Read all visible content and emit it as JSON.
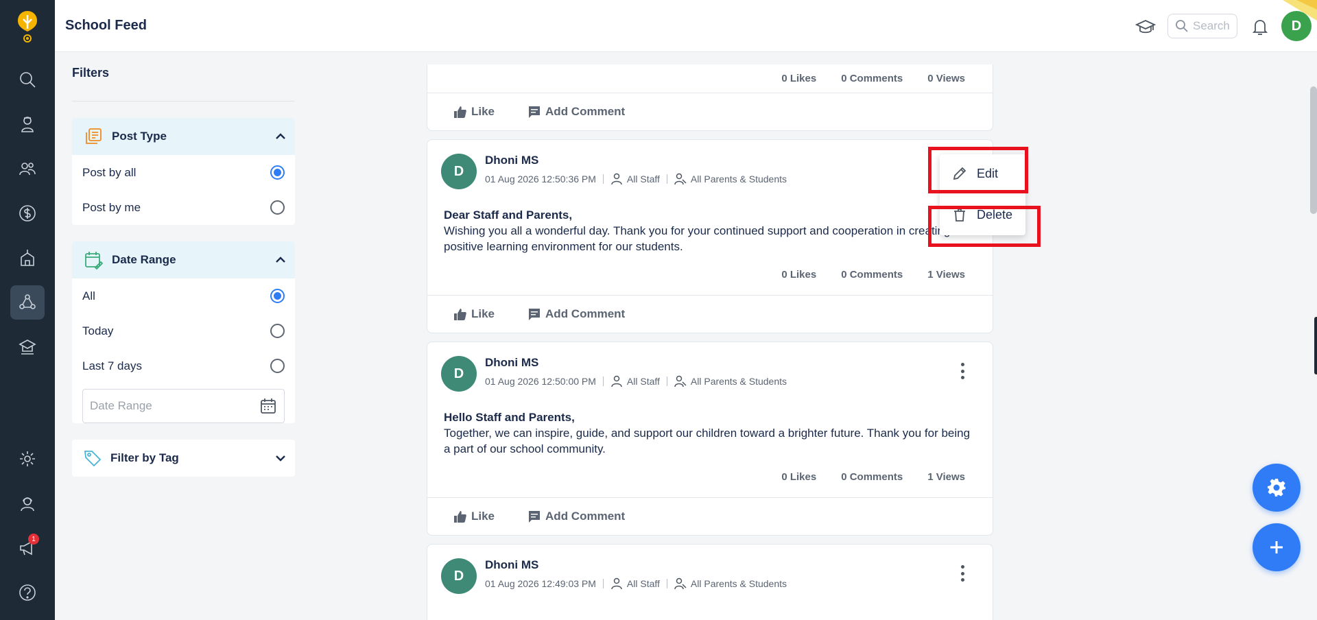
{
  "app": {
    "title": "School Feed",
    "search_placeholder": "Search",
    "user_initial": "D",
    "notification_count": "1"
  },
  "filters": {
    "heading": "Filters",
    "post_type": {
      "label": "Post Type",
      "options": [
        "Post by all",
        "Post by me"
      ],
      "selected": "Post by all"
    },
    "date_range": {
      "label": "Date Range",
      "options": [
        "All",
        "Today",
        "Last 7 days"
      ],
      "selected": "All",
      "input_placeholder": "Date Range"
    },
    "tag": {
      "label": "Filter by Tag"
    }
  },
  "feed": {
    "partial_post": {
      "likes": "0 Likes",
      "comments": "0 Comments",
      "views": "0 Views"
    },
    "like_label": "Like",
    "comment_label": "Add Comment",
    "posts": [
      {
        "initial": "D",
        "author": "Dhoni MS",
        "time": "01 Aug 2026 12:50:36 PM",
        "aud1": "All Staff",
        "aud2": "All Parents & Students",
        "greeting": "Dear Staff and Parents,",
        "body": "Wishing you all a wonderful day. Thank you for your continued support and cooperation in creating a positive learning environment for our students.",
        "likes": "0 Likes",
        "comments": "0 Comments",
        "views": "1 Views"
      },
      {
        "initial": "D",
        "author": "Dhoni MS",
        "time": "01 Aug 2026 12:50:00 PM",
        "aud1": "All Staff",
        "aud2": "All Parents & Students",
        "greeting": "Hello Staff and Parents,",
        "body": "Together, we can inspire, guide, and support our children toward a brighter future. Thank you for being a part of our school community.",
        "likes": "0 Likes",
        "comments": "0 Comments",
        "views": "1 Views"
      },
      {
        "initial": "D",
        "author": "Dhoni MS",
        "time": "01 Aug 2026 12:49:03 PM",
        "aud1": "All Staff",
        "aud2": "All Parents & Students"
      }
    ]
  },
  "menu": {
    "edit": "Edit",
    "delete": "Delete"
  },
  "colors": {
    "accent": "#2f7cf6",
    "rail": "#1e2a36",
    "highlight": "#e8121e",
    "avatar_user": "#3aa24d",
    "avatar_post": "#3e8a76"
  }
}
